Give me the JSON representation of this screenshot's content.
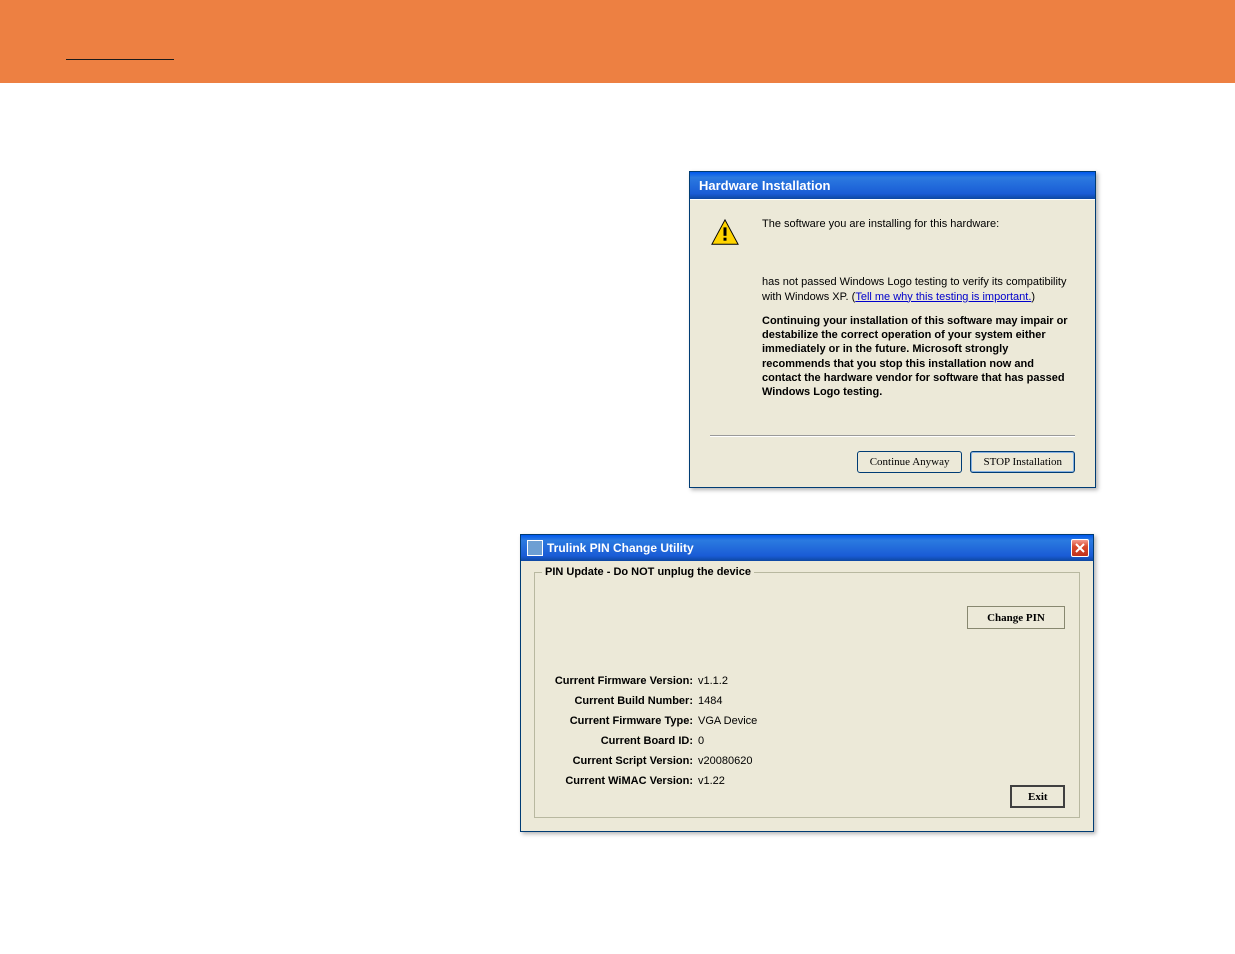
{
  "hardware_dialog": {
    "title": "Hardware Installation",
    "intro": "The software you are installing for this hardware:",
    "logo_test_pre": "has not passed Windows Logo testing to verify its compatibility with Windows XP. (",
    "logo_test_link": "Tell me why this testing is important.",
    "logo_test_post": ")",
    "warning": "Continuing your installation of this software may impair or destabilize the correct operation of your system either immediately or in the future. Microsoft strongly recommends that you stop this installation now and contact the hardware vendor for software that has passed Windows Logo testing.",
    "continue_label": "Continue Anyway",
    "stop_label": "STOP Installation"
  },
  "pin_dialog": {
    "title": "Trulink PIN Change Utility",
    "fieldset_legend": "PIN Update - Do NOT unplug the device",
    "change_pin_label": "Change PIN",
    "exit_label": "Exit",
    "rows": [
      {
        "label": "Current Firmware Version:",
        "value": "v1.1.2"
      },
      {
        "label": "Current Build Number:",
        "value": "1484"
      },
      {
        "label": "Current Firmware Type:",
        "value": "VGA Device"
      },
      {
        "label": "Current Board ID:",
        "value": "0"
      },
      {
        "label": "Current Script Version:",
        "value": "v20080620"
      },
      {
        "label": "Current WiMAC Version:",
        "value": "v1.22"
      }
    ]
  }
}
